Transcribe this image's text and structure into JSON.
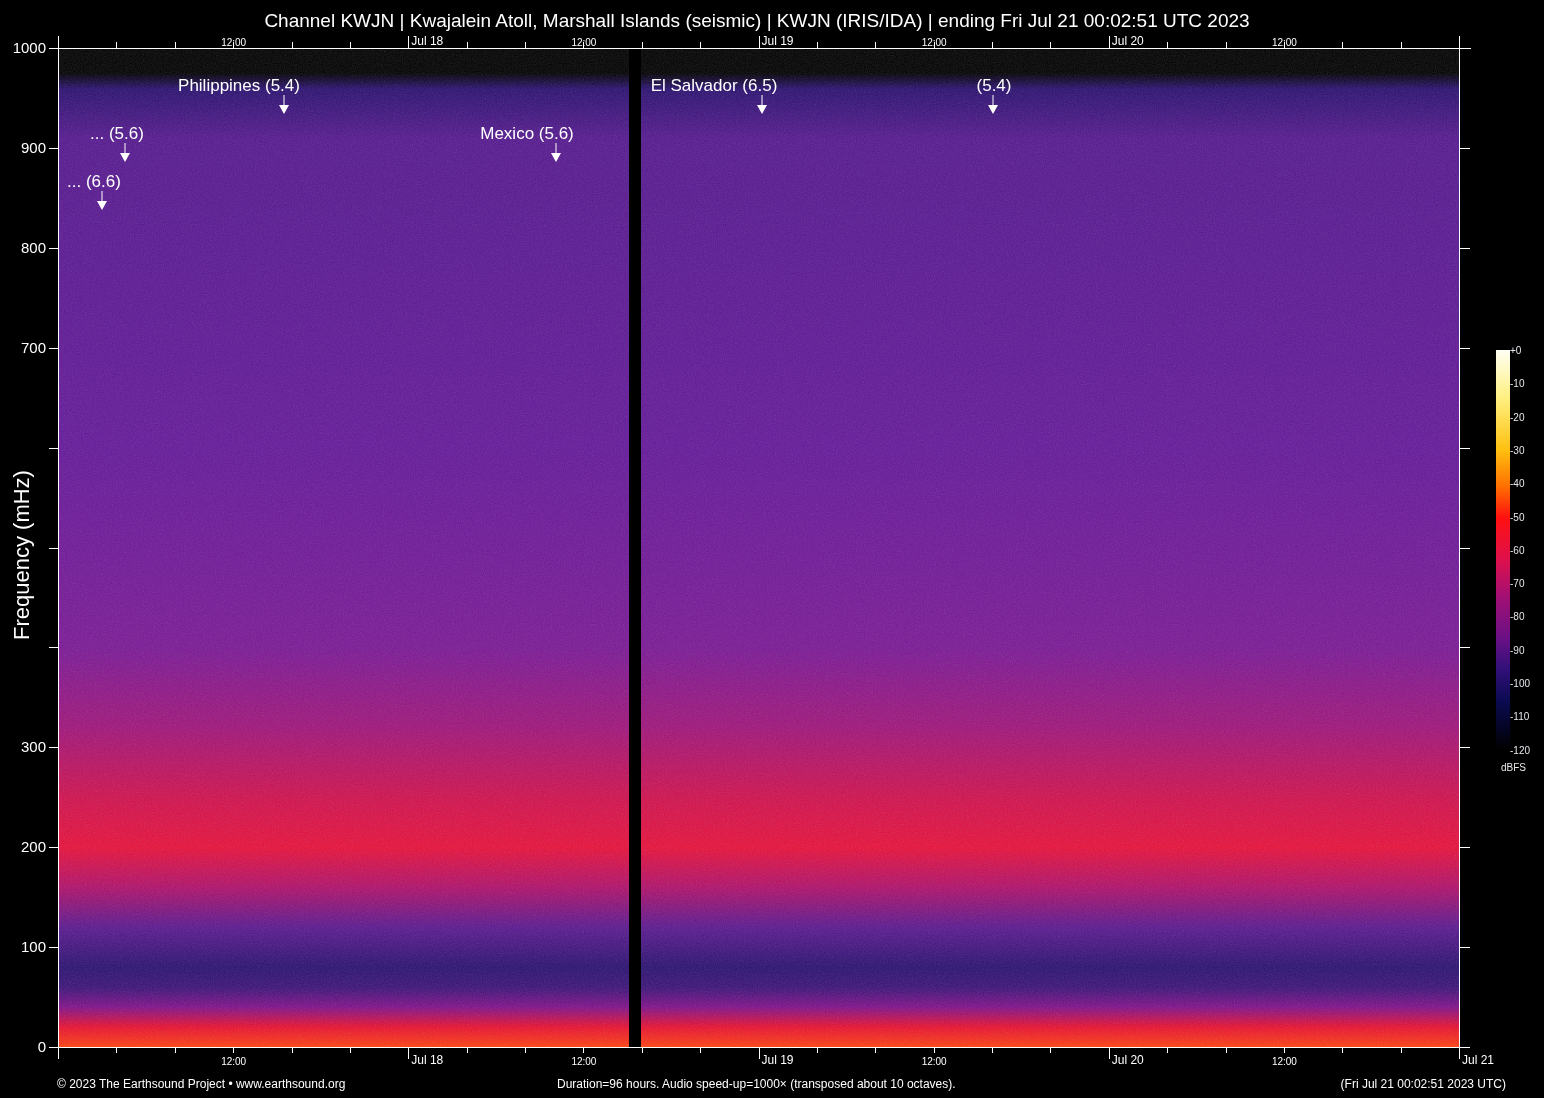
{
  "title": "Channel KWJN | Kwajalein Atoll, Marshall Islands (seismic) | KWJN (IRIS/IDA) | ending Fri Jul 21 00:02:51 UTC 2023",
  "y_axis": {
    "label": "Frequency (mHz)",
    "ticks": [
      "1000",
      "900",
      "800",
      "700",
      "300",
      "200",
      "100",
      "0"
    ]
  },
  "x_axis_top": {
    "ticks": [
      "12:00",
      "Jul 18",
      "12:00",
      "Jul 19",
      "12:00",
      "Jul 20",
      "12:00"
    ]
  },
  "x_axis_bottom": {
    "ticks": [
      "12:00",
      "Jul 18",
      "12:00",
      "Jul 19",
      "12:00",
      "Jul 20",
      "12:00",
      "Jul 21"
    ]
  },
  "events": [
    {
      "label": "Philippines (5.4)"
    },
    {
      "label": "... (5.6)"
    },
    {
      "label": "... (6.6)"
    },
    {
      "label": "Mexico (5.6)"
    },
    {
      "label": "El Salvador (6.5)"
    },
    {
      "label": "(5.4)"
    }
  ],
  "colorbar": {
    "ticks": [
      "+0",
      "-10",
      "-20",
      "-30",
      "-40",
      "-50",
      "-60",
      "-70",
      "-80",
      "-90",
      "-100",
      "-110",
      "-120"
    ],
    "unit": "dBFS"
  },
  "footer": {
    "left": "© 2023 The Earthsound Project • www.earthsound.org",
    "center": "Duration=96 hours. Audio speed-up=1000× (transposed about 10 octaves).",
    "right": "(Fri Jul 21 00:02:51 2023 UTC)"
  }
}
